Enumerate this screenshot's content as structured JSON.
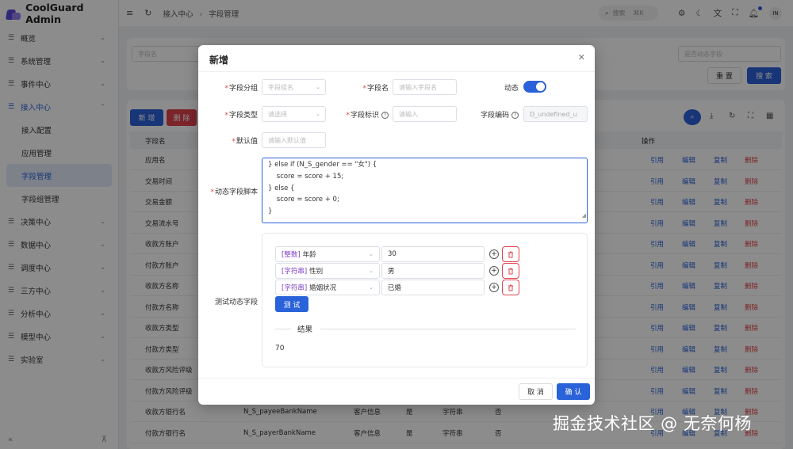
{
  "app": {
    "title": "CoolGuard Admin"
  },
  "sidebar": {
    "items": [
      {
        "label": "概览"
      },
      {
        "label": "系统管理"
      },
      {
        "label": "事件中心"
      },
      {
        "label": "接入中心"
      },
      {
        "label": "决策中心"
      },
      {
        "label": "数据中心"
      },
      {
        "label": "调度中心"
      },
      {
        "label": "三方中心"
      },
      {
        "label": "分析中心"
      },
      {
        "label": "模型中心"
      },
      {
        "label": "实验室"
      }
    ],
    "sub_items": [
      {
        "label": "接入配置"
      },
      {
        "label": "应用管理"
      },
      {
        "label": "字段管理"
      },
      {
        "label": "字段组管理"
      }
    ],
    "collapse": "«",
    "pin": "⊼"
  },
  "header": {
    "breadcrumb": [
      "接入中心",
      "字段管理"
    ],
    "search_label": "搜索",
    "search_kbd": "⌘K",
    "avatar": "IN"
  },
  "filters": {
    "field_name_placeholder": "字段名",
    "dynamic_placeholder": "是否动态字段",
    "reset": "重 置",
    "search": "搜 索"
  },
  "toolbar": {
    "add": "新 增",
    "delete": "删 除"
  },
  "table": {
    "headers": {
      "field_name": "字段名",
      "ops": "操作"
    },
    "ops": {
      "ref": "引用",
      "edit": "编辑",
      "copy": "复制",
      "del": "删除"
    },
    "rows": [
      {
        "name": "应用名",
        "code": "",
        "group": "",
        "dyn": "",
        "type": "",
        "req": ""
      },
      {
        "name": "交易时间",
        "code": "",
        "group": "",
        "dyn": "",
        "type": "",
        "req": ""
      },
      {
        "name": "交易金额",
        "code": "",
        "group": "",
        "dyn": "",
        "type": "",
        "req": ""
      },
      {
        "name": "交易流水号",
        "code": "",
        "group": "",
        "dyn": "",
        "type": "",
        "req": ""
      },
      {
        "name": "收款方账户",
        "code": "",
        "group": "",
        "dyn": "",
        "type": "",
        "req": ""
      },
      {
        "name": "付款方账户",
        "code": "",
        "group": "",
        "dyn": "",
        "type": "",
        "req": ""
      },
      {
        "name": "收款方名称",
        "code": "",
        "group": "",
        "dyn": "",
        "type": "",
        "req": ""
      },
      {
        "name": "付款方名称",
        "code": "",
        "group": "",
        "dyn": "",
        "type": "",
        "req": ""
      },
      {
        "name": "收款方类型",
        "code": "",
        "group": "",
        "dyn": "",
        "type": "",
        "req": ""
      },
      {
        "name": "付款方类型",
        "code": "",
        "group": "",
        "dyn": "",
        "type": "",
        "req": ""
      },
      {
        "name": "收款方风险评级",
        "code": "",
        "group": "",
        "dyn": "",
        "type": "",
        "req": ""
      },
      {
        "name": "付款方风险评级",
        "code": "",
        "group": "",
        "dyn": "",
        "type": "",
        "req": ""
      },
      {
        "name": "收款方银行名",
        "code": "N_S_payeeBankName",
        "group": "客户信息",
        "dyn": "是",
        "type": "字符串",
        "req": "否"
      },
      {
        "name": "付款方银行名",
        "code": "N_S_payerBankName",
        "group": "客户信息",
        "dyn": "是",
        "type": "字符串",
        "req": "否"
      }
    ]
  },
  "modal": {
    "title": "新增",
    "labels": {
      "group": "字段分组",
      "name": "字段名",
      "dynamic": "动态",
      "type": "字段类型",
      "identifier": "字段标识",
      "code": "字段编码",
      "default": "默认值",
      "script": "动态字段脚本",
      "test": "测试动态字段"
    },
    "placeholders": {
      "group": "字段组名",
      "name": "请输入字段名",
      "type": "请选择",
      "identifier": "请输入",
      "default": "请输入默认值"
    },
    "code_value": "D_undefined_u",
    "script_lines": [
      "} else if (N_S_gender == \"女\") {",
      "    score = score + 15;",
      "} else {",
      "    score = score + 0;",
      "}"
    ],
    "test_rows": [
      {
        "type": "[整数]",
        "field": "年龄",
        "value": "30"
      },
      {
        "type": "[字符串]",
        "field": "性别",
        "value": "男"
      },
      {
        "type": "[字符串]",
        "field": "婚姻状况",
        "value": "已婚"
      }
    ],
    "test_button": "测 试",
    "result_label": "结果",
    "result_value": "70",
    "cancel": "取 消",
    "confirm": "确 认"
  },
  "watermark": "掘金技术社区 @ 无奈何杨",
  "colors": {
    "primary": "#2a62d9",
    "danger": "#e0434e",
    "purple": "#7c3cc8"
  }
}
